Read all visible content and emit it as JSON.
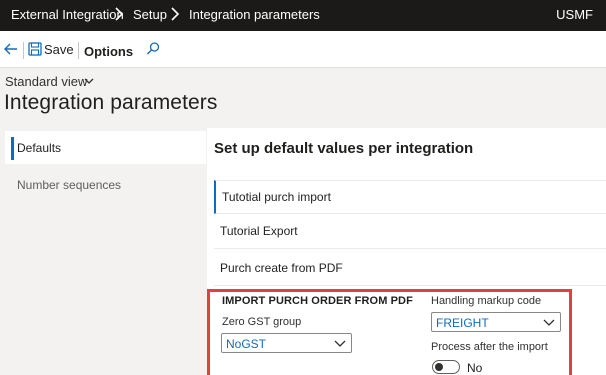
{
  "topnav": {
    "breadcrumbs": [
      "External Integration",
      "Setup",
      "Integration parameters"
    ],
    "company": "USMF"
  },
  "actionbar": {
    "save_label": "Save",
    "options_label": "Options"
  },
  "header": {
    "view_name": "Standard view",
    "page_title": "Integration parameters"
  },
  "tabs": [
    {
      "label": "Defaults",
      "selected": true
    },
    {
      "label": "Number sequences",
      "selected": false
    }
  ],
  "main": {
    "section_title": "Set up default values per integration",
    "rows": [
      {
        "label": "Tutotial purch import"
      },
      {
        "label": "Tutorial Export"
      },
      {
        "label": "Purch create from PDF"
      }
    ],
    "details": {
      "group_title": "IMPORT PURCH ORDER FROM PDF",
      "zero_gst_label": "Zero GST group",
      "zero_gst_value": "NoGST",
      "handling_markup_label": "Handling markup code",
      "handling_markup_value": "FREIGHT",
      "process_after_label": "Process after the import",
      "process_after_value": "No"
    }
  },
  "colors": {
    "topnav_bg": "#1b1a19",
    "accent": "#0f6cbd",
    "highlight": "#e04141"
  }
}
